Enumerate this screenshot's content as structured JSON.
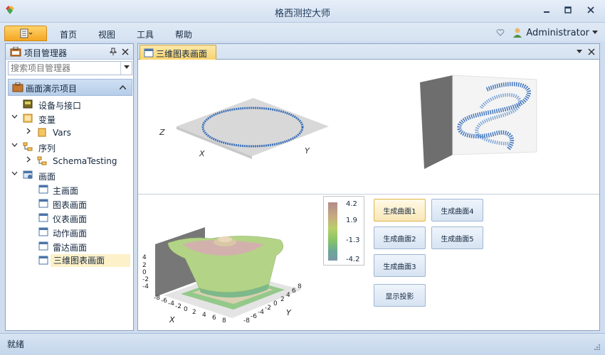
{
  "window": {
    "title": "格西测控大师",
    "controls": [
      "minimize-icon",
      "maximize-icon",
      "close-icon"
    ]
  },
  "menu": {
    "items": [
      "首页",
      "视图",
      "工具",
      "帮助"
    ],
    "user": "Administrator"
  },
  "left_panel": {
    "title": "项目管理器",
    "search_placeholder": "搜索项目管理器",
    "project": "画面演示项目",
    "tree": [
      {
        "label": "设备与接口",
        "icon": "device-icon",
        "level": 1
      },
      {
        "label": "变量",
        "icon": "variables-icon",
        "level": 0,
        "expanded": true
      },
      {
        "label": "Vars",
        "icon": "folder-icon",
        "level": 1,
        "expandable": true
      },
      {
        "label": "序列",
        "icon": "sequence-icon",
        "level": 0,
        "expanded": true
      },
      {
        "label": "SchemaTesting",
        "icon": "sequence-icon",
        "level": 1,
        "expandable": true
      },
      {
        "label": "画面",
        "icon": "screen-group-icon",
        "level": 0,
        "expanded": true
      },
      {
        "label": "主画面",
        "icon": "window-icon",
        "level": 1
      },
      {
        "label": "图表画面",
        "icon": "window-icon",
        "level": 1
      },
      {
        "label": "仪表画面",
        "icon": "window-icon",
        "level": 1
      },
      {
        "label": "动作画面",
        "icon": "window-icon",
        "level": 1
      },
      {
        "label": "雷达画面",
        "icon": "window-icon",
        "level": 1
      },
      {
        "label": "三维图表画面",
        "icon": "window-icon",
        "level": 1,
        "selected": true
      }
    ]
  },
  "document": {
    "tab": "三维图表画面",
    "chart1": {
      "axis_labels": [
        "Z",
        "X",
        "Y"
      ]
    },
    "chart3": {
      "z_ticks": [
        "4",
        "2",
        "0",
        "-2",
        "-4"
      ],
      "x_ticks": [
        "-8",
        "-6",
        "-4",
        "-2",
        "0",
        "2",
        "4",
        "6",
        "8"
      ],
      "y_ticks": [
        "-8",
        "-6",
        "-4",
        "-2",
        "0",
        "2",
        "4",
        "6",
        "8"
      ],
      "axis_labels": [
        "X",
        "Y"
      ]
    },
    "colorbar": {
      "labels": [
        "4.2",
        "1.9",
        "-1.3",
        "-4.2"
      ]
    },
    "buttons": {
      "gen1": "生成曲面1",
      "gen2": "生成曲面2",
      "gen3": "生成曲面3",
      "gen4": "生成曲面4",
      "gen5": "生成曲面5",
      "projection": "显示投影"
    }
  },
  "status": {
    "text": "就绪"
  },
  "colors": {
    "accent": "#f5a623",
    "selection": "#fdf1c9",
    "panel_border": "#8ba4c3"
  }
}
